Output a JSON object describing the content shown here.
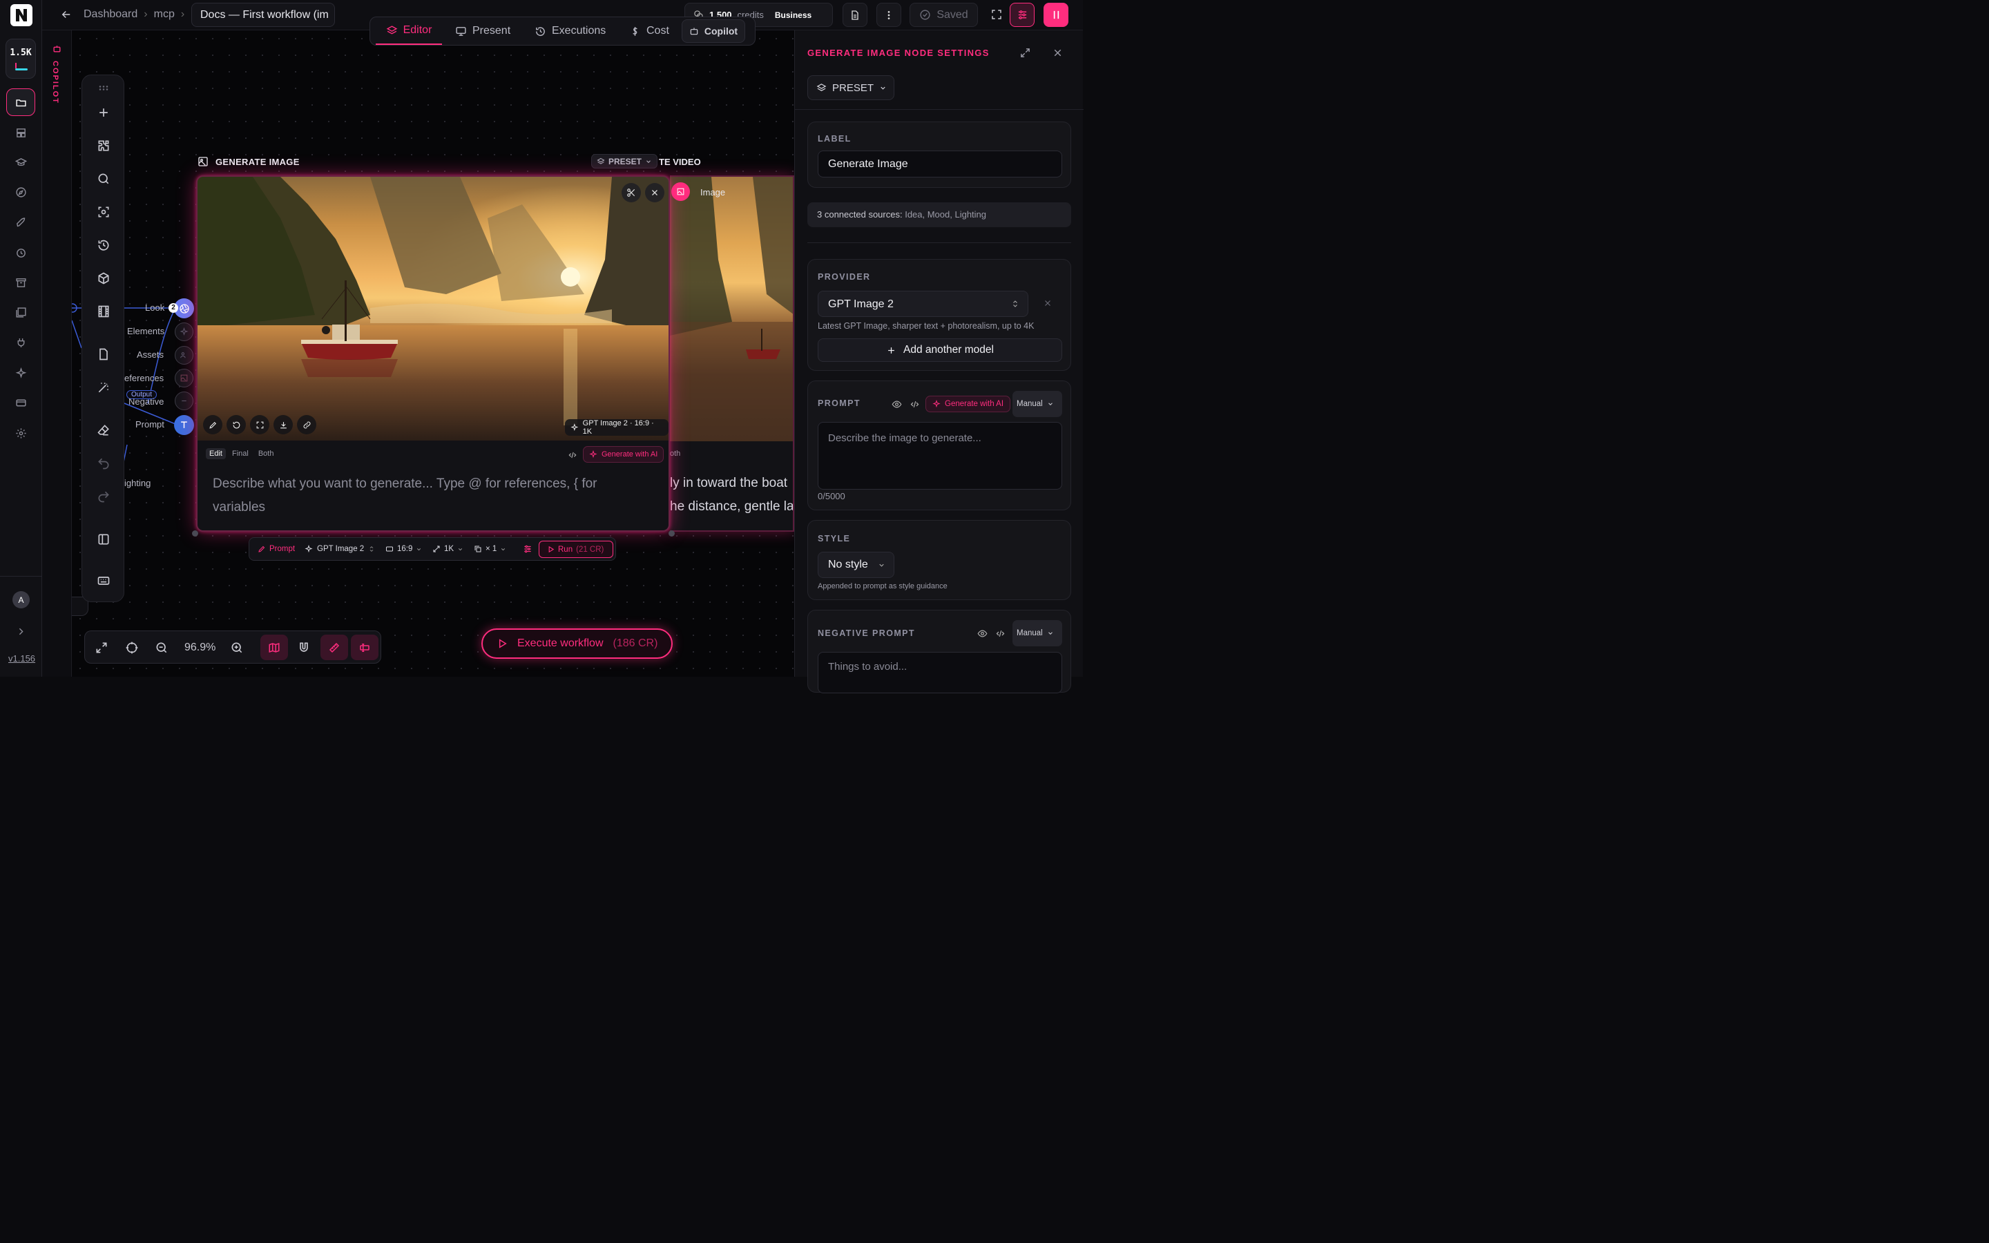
{
  "app": {
    "version": "v1.156",
    "credits_badge": "1.5K",
    "avatar_initial": "A",
    "copilot_strip": "COPILOT"
  },
  "topbar": {
    "breadcrumb": [
      "Dashboard",
      "mcp"
    ],
    "doc_title": "Docs — First workflow (im",
    "credits_amount": "1,500",
    "credits_label": "credits",
    "plan": "Business",
    "saved": "Saved"
  },
  "tabs": [
    {
      "label": "Editor",
      "active": true
    },
    {
      "label": "Present"
    },
    {
      "label": "Executions"
    },
    {
      "label": "Cost"
    },
    {
      "label": "Copilot"
    }
  ],
  "node": {
    "title": "GENERATE IMAGE",
    "second_title": "TE VIDEO",
    "preset": "PRESET",
    "image_badge": "GPT Image 2 · 16:9 · 1K",
    "edit_tabs": [
      "Edit",
      "Final",
      "Both"
    ],
    "generate_ai": "Generate with AI",
    "placeholder_line1": "Describe what you want to generate... Type @ for references, { for",
    "placeholder_line2": "variables",
    "second_image_label": "Image",
    "second_edit_tab": "oth",
    "second_text_1": "ly in toward the boat",
    "second_text_2": "he distance, gentle la",
    "inputs": [
      "Look",
      "Elements",
      "Assets",
      "eferences",
      "Negative",
      "Prompt"
    ],
    "output_tag": "Output",
    "look_count": "2",
    "left_label": "ighting"
  },
  "node_toolbar": {
    "prompt": "Prompt",
    "model": "GPT Image 2",
    "ratio": "16:9",
    "res": "1K",
    "count": "× 1",
    "run": "Run",
    "run_cost": "(21 CR)"
  },
  "bottom": {
    "zoom": "96.9%",
    "execute": "Execute workflow",
    "execute_cost": "(186 CR)"
  },
  "panel": {
    "title": "GENERATE IMAGE NODE SETTINGS",
    "preset": "PRESET",
    "label_caption": "LABEL",
    "label_value": "Generate Image",
    "sources_prefix": "3 connected sources:",
    "sources_list": "Idea, Mood, Lighting",
    "provider_caption": "PROVIDER",
    "provider_value": "GPT Image 2",
    "provider_desc": "Latest GPT Image, sharper text + photorealism, up to 4K",
    "add_model": "Add another model",
    "prompt_caption": "PROMPT",
    "prompt_ai": "Generate with AI",
    "prompt_mode": "Manual",
    "prompt_placeholder": "Describe the image to generate...",
    "prompt_count": "0/5000",
    "style_caption": "STYLE",
    "style_value": "No style",
    "style_hint": "Appended to prompt as style guidance",
    "neg_caption": "NEGATIVE PROMPT",
    "neg_mode": "Manual",
    "neg_placeholder": "Things to avoid..."
  },
  "colors": {
    "accent": "#ff2d7e",
    "bg": "#0b0b0e",
    "panel": "#101014"
  }
}
